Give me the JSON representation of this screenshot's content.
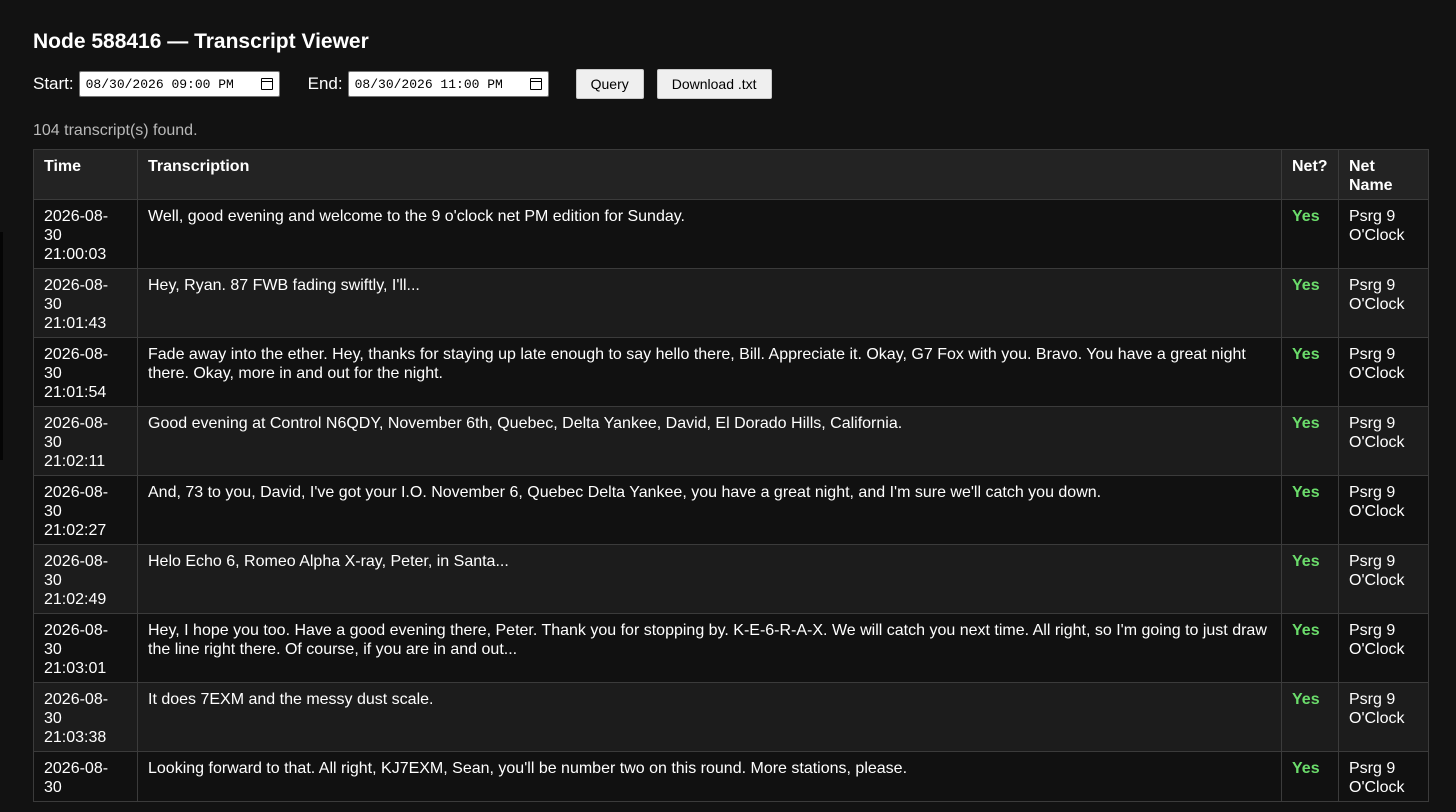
{
  "header": {
    "title": "Node 588416 — Transcript Viewer"
  },
  "controls": {
    "start_label": "Start:",
    "start_value": "08/30/2026 09:00 PM",
    "end_label": "End:",
    "end_value": "08/30/2026 11:00 PM",
    "query_label": "Query",
    "download_label": "Download .txt",
    "calendar_icon": "calendar-icon"
  },
  "status": {
    "found_text": "104 transcript(s) found."
  },
  "table": {
    "headers": {
      "time": "Time",
      "transcription": "Transcription",
      "net": "Net?",
      "net_name": "Net Name"
    },
    "rows": [
      {
        "date": "2026-08-",
        "day": "30",
        "time": "21:00:03",
        "text": "Well, good evening and welcome to the 9 o'clock net PM edition for Sunday.",
        "net": "Yes",
        "net_name": "Psrg 9 O'Clock"
      },
      {
        "date": "2026-08-",
        "day": "30",
        "time": "21:01:43",
        "text": "Hey, Ryan. 87 FWB fading swiftly, I'll...",
        "net": "Yes",
        "net_name": "Psrg 9 O'Clock"
      },
      {
        "date": "2026-08-",
        "day": "30",
        "time": "21:01:54",
        "text": "Fade away into the ether. Hey, thanks for staying up late enough to say hello there, Bill. Appreciate it. Okay, G7 Fox with you. Bravo. You have a great night there. Okay, more in and out for the night.",
        "net": "Yes",
        "net_name": "Psrg 9 O'Clock"
      },
      {
        "date": "2026-08-",
        "day": "30",
        "time": "21:02:11",
        "text": "Good evening at Control N6QDY, November 6th, Quebec, Delta Yankee, David, El Dorado Hills, California.",
        "net": "Yes",
        "net_name": "Psrg 9 O'Clock"
      },
      {
        "date": "2026-08-",
        "day": "30",
        "time": "21:02:27",
        "text": "And, 73 to you, David, I've got your I.O. November 6, Quebec Delta Yankee, you have a great night, and I'm sure we'll catch you down.",
        "net": "Yes",
        "net_name": "Psrg 9 O'Clock"
      },
      {
        "date": "2026-08-",
        "day": "30",
        "time": "21:02:49",
        "text": "Helo Echo 6, Romeo Alpha X-ray, Peter, in Santa...",
        "net": "Yes",
        "net_name": "Psrg 9 O'Clock"
      },
      {
        "date": "2026-08-",
        "day": "30",
        "time": "21:03:01",
        "text": "Hey, I hope you too. Have a good evening there, Peter. Thank you for stopping by. K-E-6-R-A-X. We will catch you next time. All right, so I'm going to just draw the line right there. Of course, if you are in and out...",
        "net": "Yes",
        "net_name": "Psrg 9 O'Clock"
      },
      {
        "date": "2026-08-",
        "day": "30",
        "time": "21:03:38",
        "text": "It does 7EXM and the messy dust scale.",
        "net": "Yes",
        "net_name": "Psrg 9 O'Clock"
      },
      {
        "date": "2026-08-",
        "day": "30",
        "time": "",
        "text": "Looking forward to that. All right, KJ7EXM, Sean, you'll be number two on this round. More stations, please.",
        "net": "Yes",
        "net_name": "Psrg 9 O'Clock"
      }
    ]
  },
  "colors": {
    "background": "#121212",
    "net_yes": "#6bdc6b",
    "status_text": "#b8b8b8"
  }
}
